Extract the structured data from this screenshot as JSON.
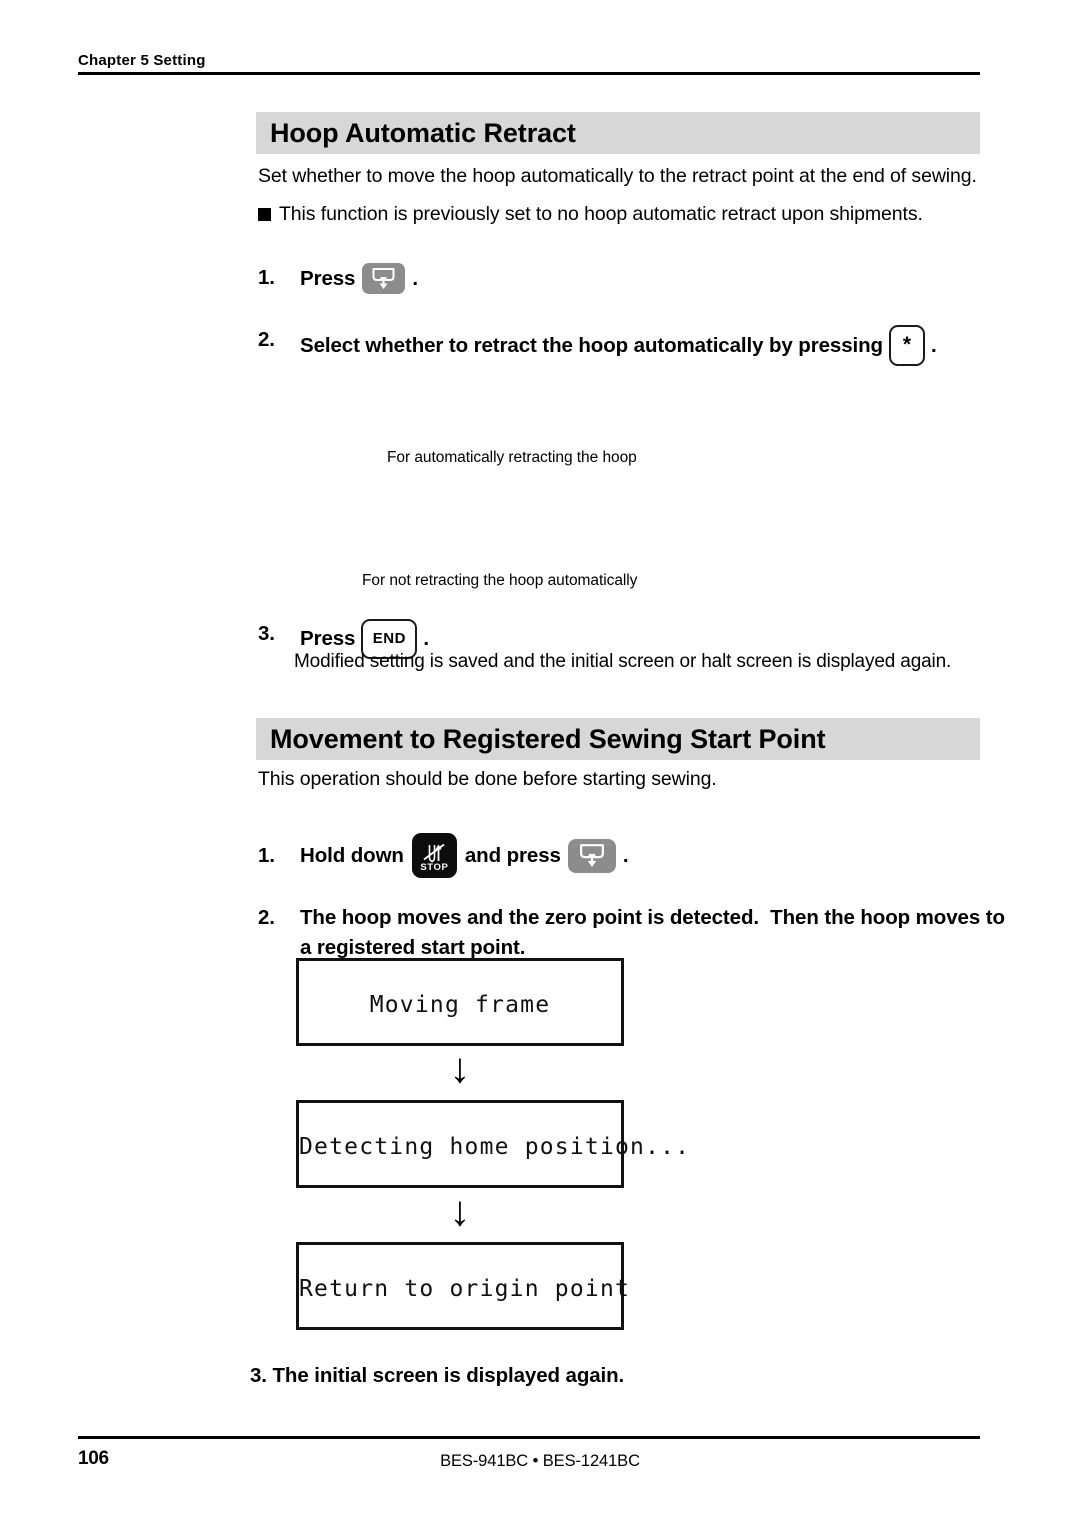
{
  "header": {
    "chapter": "Chapter 5 Setting"
  },
  "sections": [
    {
      "heading": "Hoop Automatic Retract",
      "intro": "Set whether to move the hoop automatically to the retract point at the end of sewing.",
      "bullet": "This function is previously set to no hoop automatic retract upon shipments.",
      "steps": [
        {
          "num": "1.",
          "before": "Press",
          "key": "hoop-retract-key",
          "after": "."
        },
        {
          "num": "2.",
          "before": "Select whether to retract the hoop automatically by pressing",
          "key": "asterisk-key",
          "key_label": "*",
          "after": "."
        },
        {
          "num": "3.",
          "before": "Press",
          "key": "end-key",
          "key_label": "END",
          "after": "."
        }
      ],
      "captions": [
        "For automatically retracting the hoop",
        "For not retracting the hoop automatically"
      ],
      "step3_note": "Modified setting is saved and the initial screen or halt screen is displayed again."
    },
    {
      "heading": "Movement to Registered Sewing Start Point",
      "intro": "This operation should be done before starting sewing.",
      "steps": [
        {
          "num": "1.",
          "before": "Hold down",
          "key1": "stop-key",
          "key1_label": "STOP",
          "middle": "and press",
          "key2": "hoop-retract-key",
          "after": "."
        },
        {
          "num": "2.",
          "line1": "The hoop moves and the zero point is detected.  Then the hoop moves to",
          "line2": "a registered start point."
        },
        {
          "num": "3.",
          "text": "3. The initial screen is displayed again."
        }
      ],
      "lcd_screens": [
        "Moving frame",
        "Detecting home position...",
        "Return to origin point"
      ],
      "flow_arrow": "↓"
    }
  ],
  "footer": {
    "page_number": "106",
    "model": "BES-941BC • BES-1241BC"
  },
  "colors": {
    "heading_bar": "#d7d7d7",
    "gray_key": "#8c8c8c",
    "black_key": "#0d0d0d",
    "rule": "#000000"
  }
}
